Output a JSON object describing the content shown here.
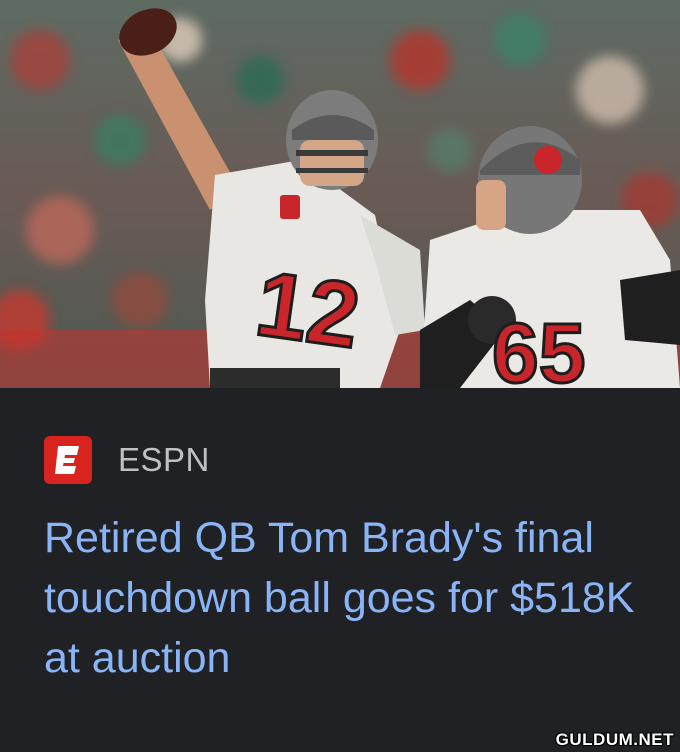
{
  "article": {
    "image_alt": "Football players in action",
    "source": {
      "name": "ESPN",
      "icon": "espn-logo-icon"
    },
    "headline": "Retired QB Tom Brady's final touchdown ball goes for $518K at auction"
  },
  "jerseys": {
    "left_number": "12",
    "right_number": "65"
  },
  "watermark": "GULDUM.NET",
  "colors": {
    "background": "#202124",
    "headline": "#8ab4f8",
    "source_text": "#bdc1c6",
    "espn_red": "#d8231f",
    "jersey_number": "#c8262a"
  }
}
